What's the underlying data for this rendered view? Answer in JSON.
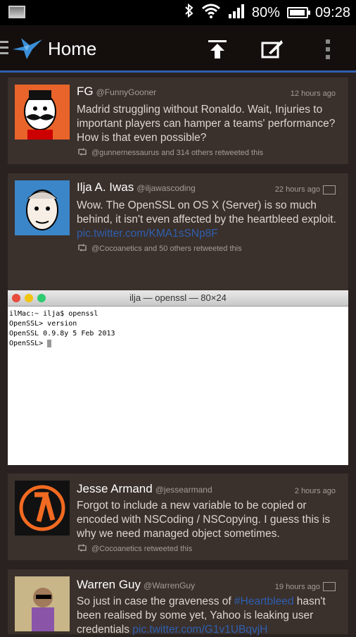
{
  "status_bar": {
    "battery": "80%",
    "time": "09:28"
  },
  "app_bar": {
    "title": "Home"
  },
  "tweets": [
    {
      "name": "FG",
      "handle": "@FunnyGooner",
      "time": "12 hours ago",
      "text": "Madrid struggling without Ronaldo. Wait, Injuries to important players can hamper a teams' performance? How is that even possible?",
      "retweet": "@gunnernessaurus and 314 others retweeted this"
    },
    {
      "name": "Ilja A. Iwas",
      "handle": "@iljawascoding",
      "time": "22 hours ago",
      "text": "Wow. The OpenSSL on OS X (Server) is so much behind, it isn't even affected by the heartbleed exploit.",
      "link": "pic.twitter.com/KMA1sSNp8F",
      "retweet": "@Cocoanetics and 50 others retweeted this",
      "media": {
        "window_title": "ilja — openssl — 80×24",
        "lines": [
          "ilMac:~ ilja$ openssl",
          "OpenSSL> version",
          "OpenSSL 0.9.8y 5 Feb 2013",
          "OpenSSL> "
        ]
      }
    },
    {
      "name": "Jesse Armand",
      "handle": "@jessearmand",
      "time": "2 hours ago",
      "text": "Forgot to include a new variable to be copied or encoded with NSCoding / NSCopying. I guess this is why we need managed object sometimes.",
      "retweet": "@Cocoanetics retweeted this"
    },
    {
      "name": "Warren Guy",
      "handle": "@WarrenGuy",
      "time": "19 hours ago",
      "text_before": "So just in case the graveness of ",
      "hashtag": "#Heartbleed",
      "text_after": " hasn't been realised by some yet, Yahoo is leaking user credentials",
      "link": "pic.twitter.com/G1v1UBqvjH"
    }
  ]
}
